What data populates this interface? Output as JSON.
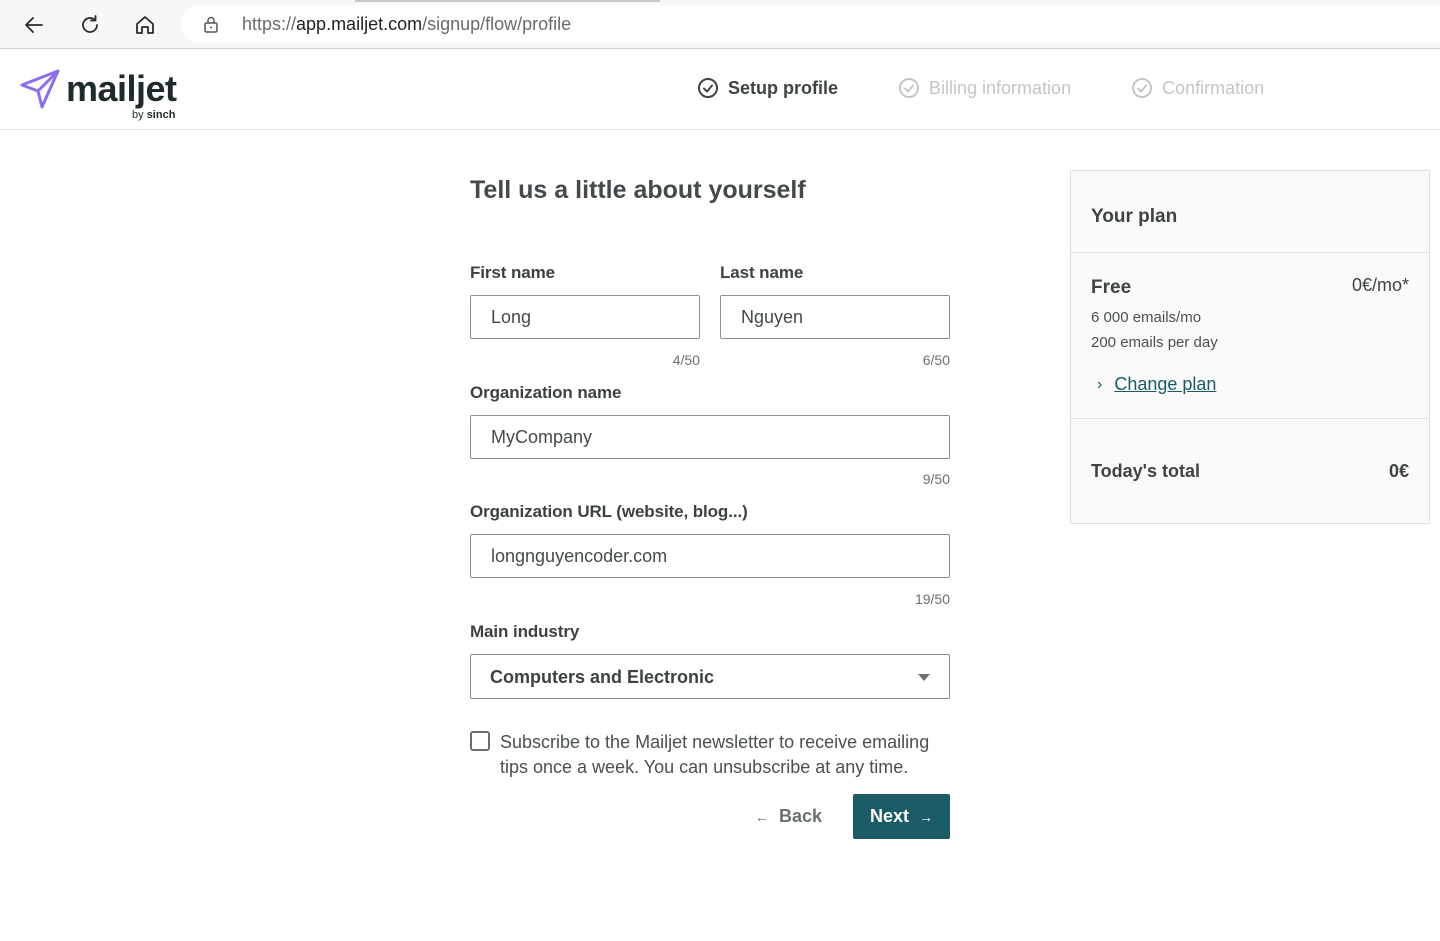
{
  "browser": {
    "url_prefix": "https://",
    "url_host": "app.mailjet.com",
    "url_path": "/signup/flow/profile"
  },
  "header": {
    "logo_word": "mailjet",
    "logo_sub_by": "by ",
    "logo_sub_brand": "sinch",
    "steps": [
      {
        "label": "Setup profile",
        "state": "active"
      },
      {
        "label": "Billing information",
        "state": "inactive"
      },
      {
        "label": "Confirmation",
        "state": "inactive"
      }
    ]
  },
  "form": {
    "title": "Tell us a little about yourself",
    "first_name": {
      "label": "First name",
      "value": "Long",
      "counter": "4/50"
    },
    "last_name": {
      "label": "Last name",
      "value": "Nguyen",
      "counter": "6/50"
    },
    "organization_name": {
      "label": "Organization name",
      "value": "MyCompany",
      "counter": "9/50"
    },
    "organization_url": {
      "label": "Organization URL (website, blog...)",
      "value": "longnguyencoder.com",
      "counter": "19/50"
    },
    "main_industry": {
      "label": "Main industry",
      "value": "Computers and Electronic"
    },
    "newsletter": {
      "label": "Subscribe to the Mailjet newsletter to receive emailing tips once a week. You can unsubscribe at any time.",
      "checked": false
    },
    "back_label": "Back",
    "next_label": "Next"
  },
  "plan": {
    "title": "Your plan",
    "name": "Free",
    "price": "0€/mo*",
    "emails_per_month": "6 000 emails/mo",
    "emails_per_day": "200 emails per day",
    "change_label": "Change plan",
    "total_label": "Today's total",
    "total_value": "0€"
  },
  "colors": {
    "accent": "#1a5b66",
    "logo_purple": "#8b6ef0"
  }
}
